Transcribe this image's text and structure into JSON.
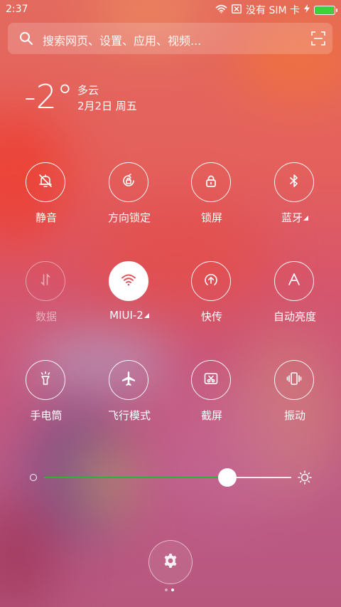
{
  "status_bar": {
    "time": "2:37",
    "carrier": "没有 SIM 卡",
    "battery_level": 1.0,
    "battery_color": "#3dd13b"
  },
  "search": {
    "placeholder": "搜索网页、设置、应用、视频...",
    "left_icon": "search-icon",
    "right_icon": "scan-icon"
  },
  "weather": {
    "temperature": "-2°",
    "condition": "多云",
    "date": "2月2日 周五"
  },
  "toggles": [
    {
      "label": "静音",
      "icon": "bell-off-icon",
      "state": "off",
      "has_arrow": false
    },
    {
      "label": "方向锁定",
      "icon": "rotation-lock-icon",
      "state": "off",
      "has_arrow": false
    },
    {
      "label": "锁屏",
      "icon": "lock-icon",
      "state": "off",
      "has_arrow": false
    },
    {
      "label": "蓝牙",
      "icon": "bluetooth-icon",
      "state": "off",
      "has_arrow": true
    },
    {
      "label": "数据",
      "icon": "mobile-data-icon",
      "state": "disabled",
      "has_arrow": false
    },
    {
      "label": "MIUI-2",
      "icon": "wifi-icon",
      "state": "on",
      "has_arrow": true
    },
    {
      "label": "快传",
      "icon": "quick-transfer-icon",
      "state": "off",
      "has_arrow": false
    },
    {
      "label": "自动亮度",
      "icon": "auto-brightness-icon",
      "state": "off",
      "has_arrow": false
    },
    {
      "label": "手电筒",
      "icon": "flashlight-icon",
      "state": "off",
      "has_arrow": false
    },
    {
      "label": "飞行模式",
      "icon": "airplane-icon",
      "state": "off",
      "has_arrow": false
    },
    {
      "label": "截屏",
      "icon": "screenshot-icon",
      "state": "off",
      "has_arrow": false
    },
    {
      "label": "振动",
      "icon": "vibrate-icon",
      "state": "off",
      "has_arrow": false
    }
  ],
  "brightness": {
    "level": 0.74,
    "fill_color": "#27b53a"
  },
  "pager": {
    "pages": 2,
    "current": 2
  },
  "settings_button_icon": "gear-icon"
}
